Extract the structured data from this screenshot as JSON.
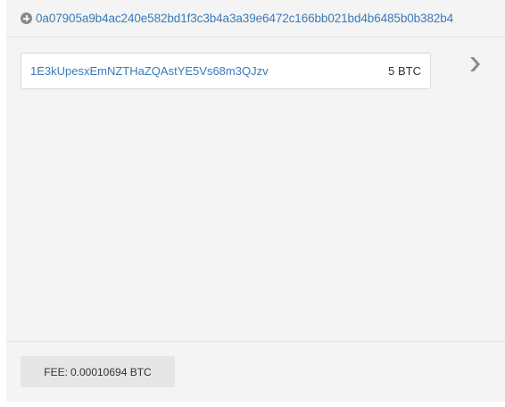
{
  "transaction": {
    "hash": "0a07905a9b4ac240e582bd1f3c3b4a3a39e6472c166bb021bd4b6485b0b382b4",
    "expand_icon": "plus-circle-icon",
    "direction_icon": "chevron-right-icon"
  },
  "outputs": [
    {
      "address": "1E3kUpesxEmNZTHaZQAstYE5Vs68m3QJzv",
      "amount": "5 BTC"
    }
  ],
  "fee": {
    "label": "FEE:",
    "value": "0.00010694 BTC"
  },
  "colors": {
    "link": "#3a7ab8",
    "panel_background": "#f4f4f4",
    "icon_gray": "#8a8a8a"
  }
}
